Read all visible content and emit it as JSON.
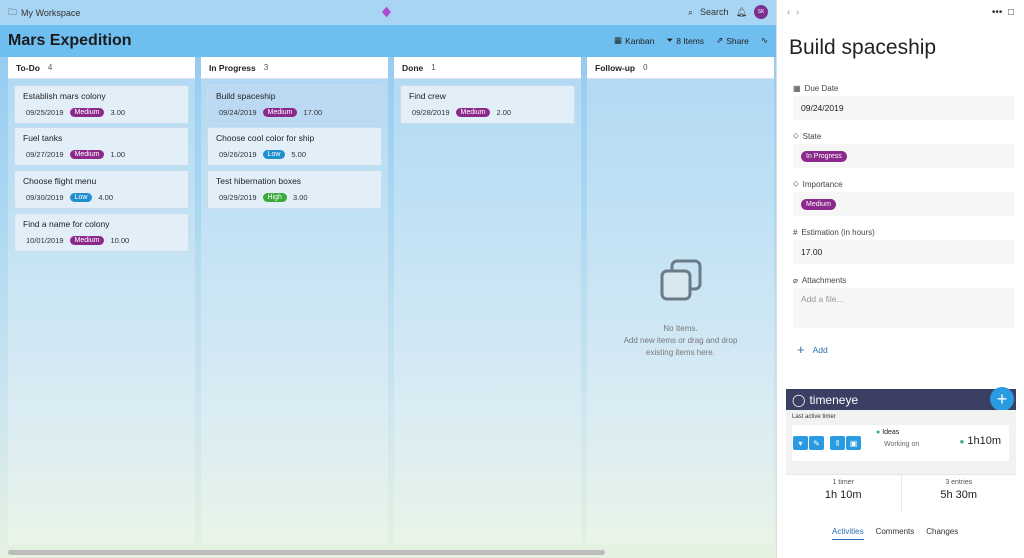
{
  "workspace": {
    "label": "My Workspace"
  },
  "topbar": {
    "search_label": "Search",
    "avatar_initials": "SK"
  },
  "board": {
    "title": "Mars Expedition",
    "actions": {
      "kanban": "Kanban",
      "items": "8 Items",
      "share": "Share"
    },
    "columns": [
      {
        "name": "To-Do",
        "count": "4",
        "cards": [
          {
            "title": "Establish mars colony",
            "date": "09/25/2019",
            "importance": "Medium",
            "hours": "3.00"
          },
          {
            "title": "Fuel tanks",
            "date": "09/27/2019",
            "importance": "Medium",
            "hours": "1.00"
          },
          {
            "title": "Choose flight menu",
            "date": "09/30/2019",
            "importance": "Low",
            "hours": "4.00"
          },
          {
            "title": "Find a name for colony",
            "date": "10/01/2019",
            "importance": "Medium",
            "hours": "10.00"
          }
        ]
      },
      {
        "name": "In Progress",
        "count": "3",
        "cards": [
          {
            "title": "Build spaceship",
            "date": "09/24/2019",
            "importance": "Medium",
            "hours": "17.00"
          },
          {
            "title": "Choose cool color for ship",
            "date": "09/26/2019",
            "importance": "Low",
            "hours": "5.00"
          },
          {
            "title": "Test hibernation boxes",
            "date": "09/29/2019",
            "importance": "High",
            "hours": "3.00"
          }
        ]
      },
      {
        "name": "Done",
        "count": "1",
        "cards": [
          {
            "title": "Find crew",
            "date": "09/28/2019",
            "importance": "Medium",
            "hours": "2.00"
          }
        ]
      },
      {
        "name": "Follow-up",
        "count": "0",
        "cards": []
      }
    ],
    "empty": {
      "line1": "No Items.",
      "line2": "Add new items or drag and drop",
      "line3": "existing items here."
    }
  },
  "detail": {
    "title": "Build spaceship",
    "due_date_label": "Due Date",
    "due_date": "09/24/2019",
    "state_label": "State",
    "state": "In Progress",
    "importance_label": "Importance",
    "importance": "Medium",
    "estimation_label": "Estimation (in hours)",
    "estimation": "17.00",
    "attachments_label": "Attachments",
    "attachments_placeholder": "Add a file...",
    "add_label": "Add"
  },
  "timeneye": {
    "brand": "timeneye",
    "last_active": "Last active timer",
    "project": "Ideas",
    "task": "Working on",
    "timer": "1h10m",
    "stat1_label": "1 timer",
    "stat1_value": "1h 10m",
    "stat2_label": "3 entries",
    "stat2_value": "5h 30m"
  },
  "tabs": [
    "Activities",
    "Comments",
    "Changes"
  ],
  "colors": {
    "medium": "#8c2a8c",
    "low": "#1f8fce",
    "high": "#3aaa3a",
    "accent": "#2a9be0"
  }
}
